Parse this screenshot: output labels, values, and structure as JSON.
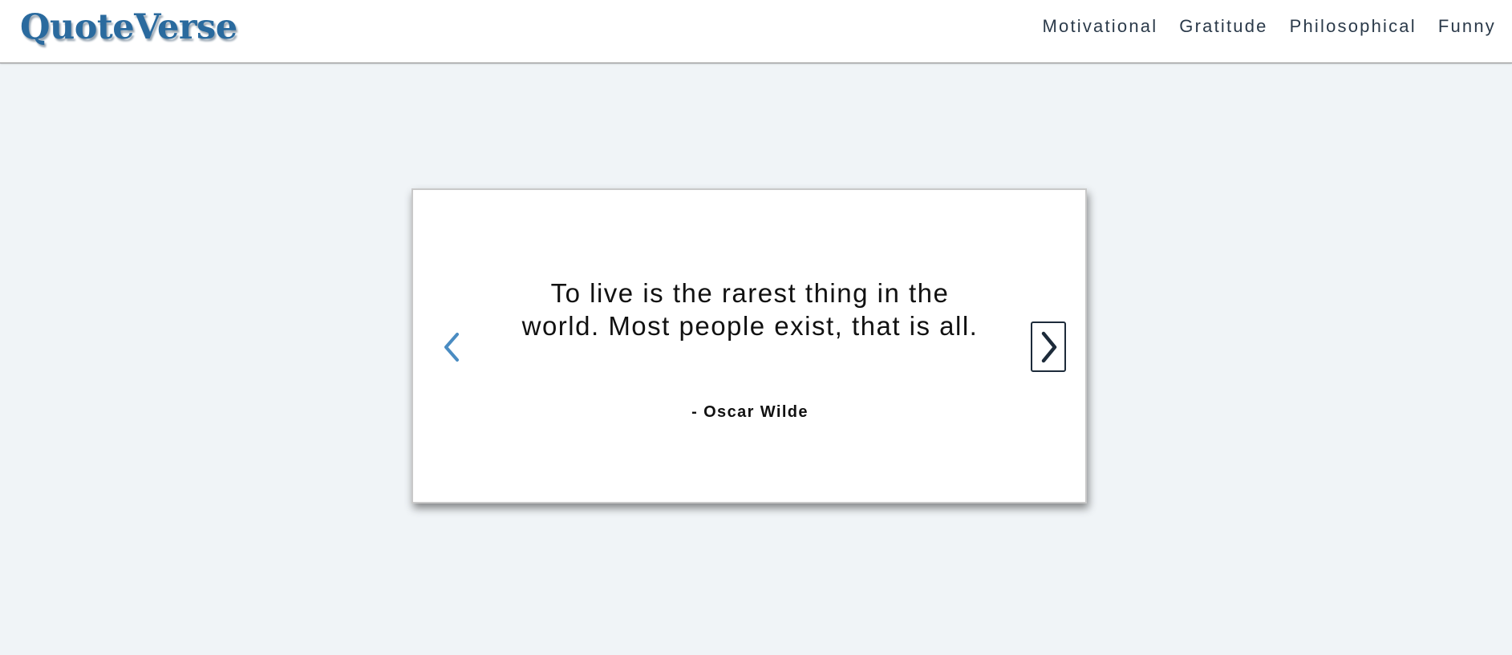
{
  "header": {
    "logo": "QuoteVerse",
    "nav": [
      {
        "label": "Motivational"
      },
      {
        "label": "Gratitude"
      },
      {
        "label": "Philosophical"
      },
      {
        "label": "Funny"
      }
    ]
  },
  "carousel": {
    "quote": "To live is the rarest thing in the world. Most people exist, that is all.",
    "author": "- Oscar Wilde",
    "prev_icon": "chevron-left-icon",
    "next_icon": "chevron-right-icon"
  },
  "colors": {
    "logo": "#2a6a9e",
    "background": "#f0f4f7",
    "nav_text": "#2b3a4a",
    "prev_arrow": "#4a8cc2",
    "next_arrow": "#1d2b3a"
  }
}
